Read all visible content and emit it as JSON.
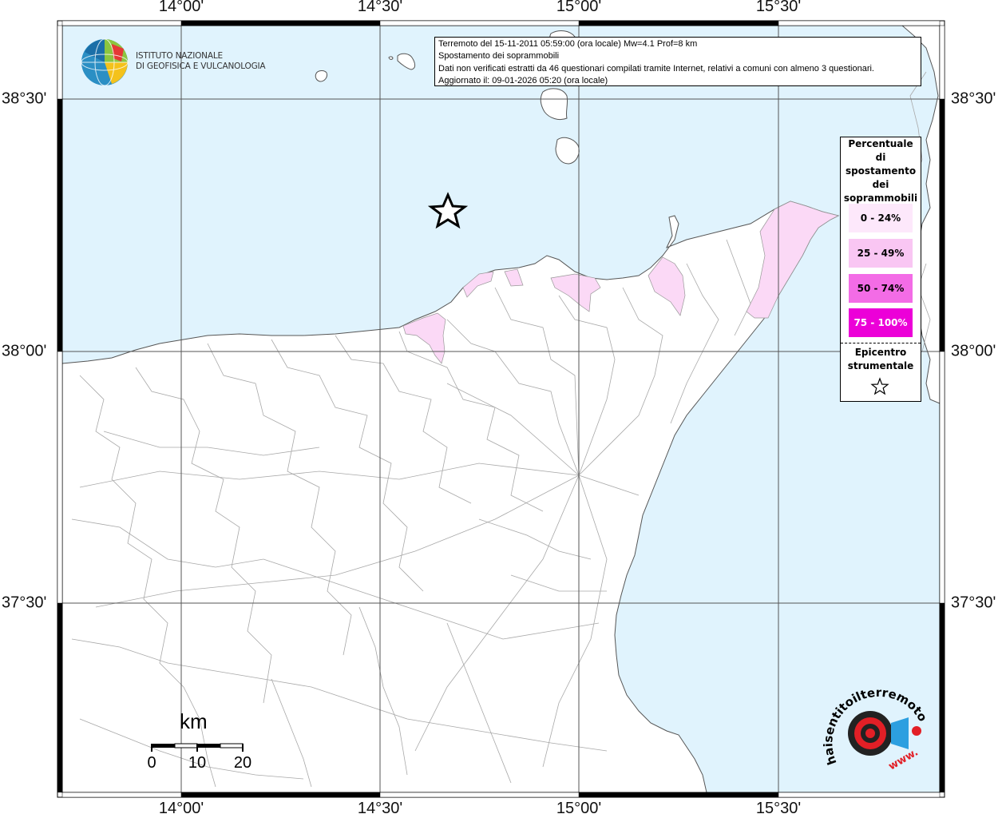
{
  "header": {
    "event_line": "Terremoto del 15-11-2011 05:59:00 (ora locale) Mw=4.1 Prof=8 km",
    "map_title": "Spostamento dei soprammobili",
    "data_note": "Dati non verificati estratti da 46 questionari compilati tramite Internet, relativi a comuni con almeno 3 questionari.",
    "updated": "Aggiornato il: 09-01-2026 05:20 (ora locale)"
  },
  "institute": {
    "line1": "ISTITUTO NAZIONALE",
    "line2": "DI GEOFISICA E VULCANOLOGIA"
  },
  "axes": {
    "lon_labels": [
      "14°00'",
      "14°30'",
      "15°00'",
      "15°30'"
    ],
    "lat_labels": [
      "38°30'",
      "38°00'",
      "37°30'"
    ]
  },
  "legend": {
    "title": "Percentuale di spostamento dei soprammobili",
    "title_lines": [
      "Percentuale",
      "di",
      "spostamento",
      "dei",
      "soprammobili"
    ],
    "classes": [
      {
        "label": "0 - 24%",
        "color": "#fde8fb",
        "text_color": "#000000"
      },
      {
        "label": "25 - 49%",
        "color": "#f9c6f3",
        "text_color": "#000000"
      },
      {
        "label": "50 - 74%",
        "color": "#f36ce6",
        "text_color": "#000000"
      },
      {
        "label": "75 - 100%",
        "color": "#ec00d8",
        "text_color": "#ffffff"
      }
    ],
    "epicenter_line1": "Epicentro",
    "epicenter_line2": "strumentale"
  },
  "scale": {
    "unit": "km",
    "ticks": [
      "0",
      "10",
      "20"
    ]
  },
  "watermark": {
    "text": "haisentitoilterremoto.it",
    "url": "www."
  },
  "colors": {
    "sea": "#e0f3fd",
    "land": "#ffffff",
    "grid": "#555555",
    "boundary": "#9a9a9a",
    "affected_light": "#fbd9f6"
  }
}
